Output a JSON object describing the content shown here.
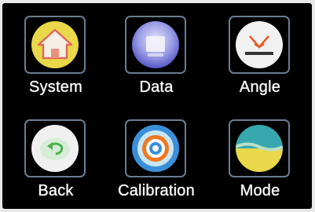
{
  "menu": {
    "items": [
      {
        "label": "System",
        "icon": "home-icon"
      },
      {
        "label": "Data",
        "icon": "data-icon"
      },
      {
        "label": "Angle",
        "icon": "angle-icon"
      },
      {
        "label": "Back",
        "icon": "back-icon"
      },
      {
        "label": "Calibration",
        "icon": "calibration-icon"
      },
      {
        "label": "Mode",
        "icon": "mode-icon"
      }
    ]
  },
  "colors": {
    "frame": "#6a7c90",
    "system_circle": "#e8d84a",
    "data_circle": "#6c6fd0",
    "angle_circle": "#f2f2f2",
    "angle_accent": "#e85a1e",
    "back_circle": "#f0f0f0",
    "back_arrow": "#4caf50",
    "calibration_blue": "#3a8fd8",
    "calibration_orange": "#f07820",
    "mode_yellow": "#e8d84a",
    "mode_teal": "#38a8b0"
  }
}
